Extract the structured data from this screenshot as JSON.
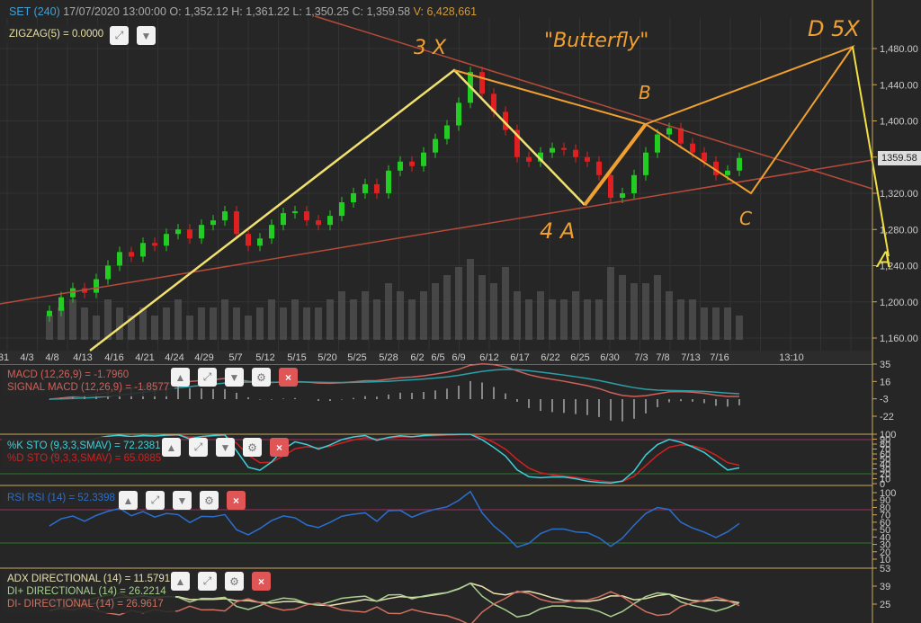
{
  "header": {
    "symbol": "SET (240)",
    "datetime": "17/07/2020 13:00:00",
    "o_label": "O:",
    "open": "1,352.12",
    "h_label": "H:",
    "high": "1,361.22",
    "l_label": "L:",
    "low": "1,350.25",
    "c_label": "C:",
    "close": "1,359.58",
    "v_label": "V:",
    "volume": "6,428,661"
  },
  "zigzag_label": "ZIGZAG(5) = 0.0000",
  "current_price": "1359.58",
  "macd": {
    "line1": "MACD (12,26,9) = -1.7960",
    "line2": "SIGNAL MACD (12,26,9) = -1.8577",
    "axis": [
      "35",
      "16",
      "-3",
      "-22"
    ]
  },
  "sto": {
    "line1": "%K STO (9,3,3,SMAV) = 72.2381",
    "line2": "%D STO (9,3,3,SMAV) = 65.0885",
    "axis": [
      "100",
      "90",
      "80",
      "70",
      "60",
      "50",
      "40",
      "30",
      "20",
      "10",
      "0"
    ]
  },
  "rsi": {
    "line1": "RSI RSI (14) = 52.3398",
    "axis": [
      "100",
      "90",
      "80",
      "70",
      "60",
      "50",
      "40",
      "30",
      "20",
      "10"
    ]
  },
  "adx": {
    "line1": "ADX DIRECTIONAL (14) = 11.5791",
    "line2": "DI+ DIRECTIONAL (14) = 26.2214",
    "line3": "DI- DIRECTIONAL (14) = 26.9617",
    "axis": [
      "53",
      "39",
      "25"
    ]
  },
  "annotations": {
    "x3": "3 X",
    "title": "\"Butterfly\"",
    "b": "B",
    "a4": "4 A",
    "c": "C",
    "d5x": "D 5X",
    "a": "A"
  },
  "colors": {
    "up": "#22cc22",
    "down": "#e02020",
    "macd": "#d0605a",
    "signal": "#2aa0a8",
    "stoK": "#3fd0d8",
    "stoD": "#d02020",
    "rsi": "#2a6fd0",
    "adx": "#e8e0b0",
    "diplus": "#a8d090",
    "diminus": "#d07060"
  },
  "chart_data": {
    "type": "candlestick",
    "price_axis": [
      "1,480.00",
      "1,440.00",
      "1,400.00",
      "1,360.00",
      "1,320.00",
      "1,280.00",
      "1,240.00",
      "1,200.00",
      "1,160.00"
    ],
    "ylim": [
      1160,
      1480
    ],
    "x_labels": [
      "31",
      "4/3",
      "4/8",
      "4/13",
      "4/16",
      "4/21",
      "4/24",
      "4/29",
      "5/7",
      "5/12",
      "5/15",
      "5/20",
      "5/25",
      "5/28",
      "6/2",
      "6/5",
      "6/9",
      "6/12",
      "6/17",
      "6/22",
      "6/25",
      "6/30",
      "7/3",
      "7/8",
      "7/13",
      "7/16",
      "13:10"
    ],
    "closes": [
      1190,
      1205,
      1215,
      1210,
      1225,
      1240,
      1255,
      1250,
      1265,
      1262,
      1275,
      1280,
      1270,
      1285,
      1290,
      1300,
      1275,
      1262,
      1270,
      1285,
      1298,
      1300,
      1290,
      1285,
      1295,
      1310,
      1320,
      1330,
      1320,
      1345,
      1355,
      1350,
      1365,
      1380,
      1395,
      1420,
      1454,
      1430,
      1410,
      1390,
      1360,
      1355,
      1365,
      1370,
      1368,
      1360,
      1355,
      1340,
      1315,
      1320,
      1340,
      1365,
      1385,
      1392,
      1375,
      1365,
      1355,
      1340,
      1345,
      1359
    ],
    "volumes": [
      3,
      4,
      5,
      4,
      3,
      5,
      4,
      3,
      4,
      3,
      4,
      5,
      3,
      4,
      4,
      5,
      4,
      3,
      4,
      5,
      4,
      5,
      4,
      4,
      5,
      6,
      5,
      6,
      5,
      7,
      6,
      5,
      6,
      7,
      8,
      9,
      10,
      8,
      7,
      9,
      6,
      5,
      6,
      5,
      5,
      6,
      5,
      5,
      9,
      8,
      7,
      7,
      8,
      6,
      5,
      5,
      4,
      4,
      4,
      3
    ]
  }
}
